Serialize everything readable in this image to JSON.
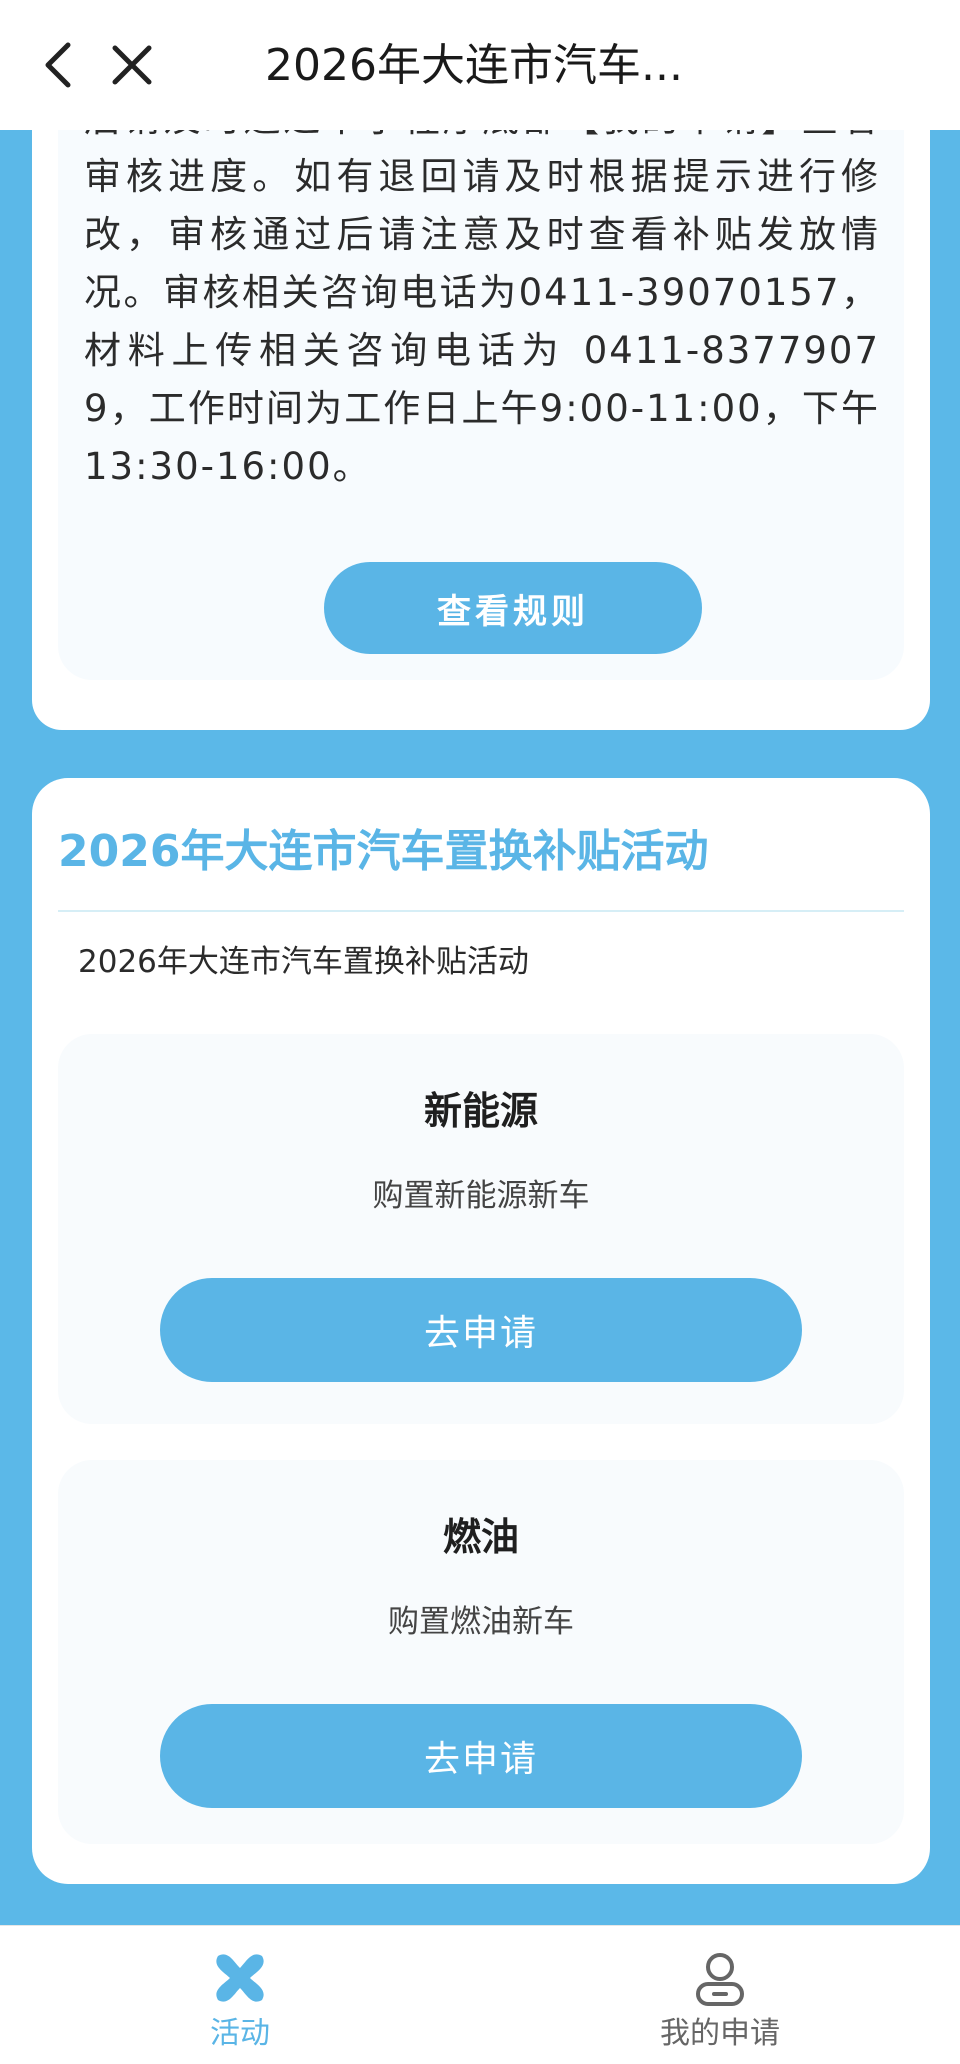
{
  "header": {
    "title": "2026年大连市汽车...",
    "back_icon": "chevron-left-icon",
    "close_icon": "close-icon"
  },
  "rules": {
    "text": "后请及时通过本小程序底部【我的申请】查看审核进度。如有退回请及时根据提示进行修改，审核通过后请注意及时查看补贴发放情况。审核相关咨询电话为0411-39070157，材料上传相关咨询电话为 0411-83779079，工作时间为工作日上午9:00-11:00，下午13:30-16:00。",
    "button_label": "查看规则"
  },
  "activity": {
    "title": "2026年大连市汽车置换补贴活动",
    "subtitle": "2026年大连市汽车置换补贴活动",
    "options": [
      {
        "title": "新能源",
        "description": "购置新能源新车",
        "button_label": "去申请"
      },
      {
        "title": "燃油",
        "description": "购置燃油新车",
        "button_label": "去申请"
      }
    ]
  },
  "bottom_nav": {
    "items": [
      {
        "label": "活动",
        "icon": "activity-icon",
        "active": true
      },
      {
        "label": "我的申请",
        "icon": "user-icon",
        "active": false
      }
    ]
  },
  "colors": {
    "primary": "#5ab5e6",
    "page_background": "#5bb8e8",
    "text": "#2b2b2b"
  }
}
